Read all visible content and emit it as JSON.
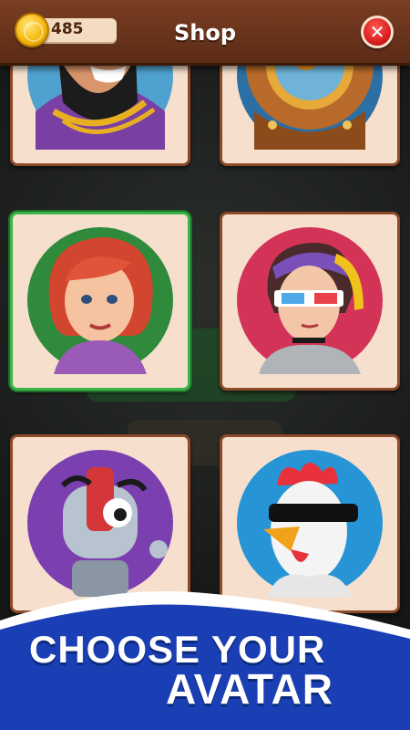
{
  "header": {
    "coins": "485",
    "title": "Shop",
    "close_label": "✕"
  },
  "avatars": [
    {
      "name": "bearded-man"
    },
    {
      "name": "diving-helmet"
    },
    {
      "name": "red-haired-woman",
      "selected": true
    },
    {
      "name": "woman-3d-glasses"
    },
    {
      "name": "robot"
    },
    {
      "name": "rooster-sunglasses"
    }
  ],
  "banner": {
    "line1": "CHOOSE YOUR",
    "line2": "AVATAR"
  },
  "colors": {
    "header_brown": "#6b3419",
    "card_bg": "#f6e0cd",
    "selected_border": "#3ab54a",
    "banner_blue": "#1a3fb5",
    "close_red": "#d41c1c",
    "coin_gold": "#f6b80c"
  }
}
